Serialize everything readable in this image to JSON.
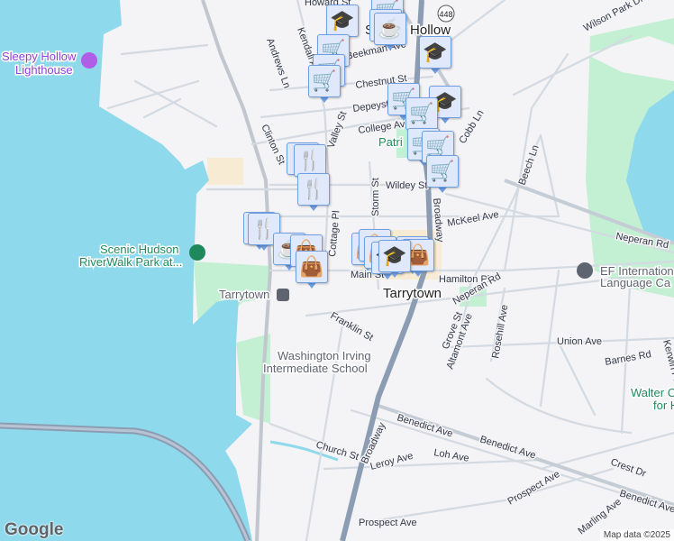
{
  "map": {
    "colors": {
      "water": "#8fd9ec",
      "land": "#f4f3f5",
      "park": "#c3efd2",
      "road": "#d3dae2",
      "highway": "#8c9db3",
      "marker_bg": "#dfe9fb",
      "marker_icon": "#0b4266"
    },
    "towns": {
      "sleepy_hollow": "Sleepy Hollow",
      "tarrytown": "Tarrytown"
    },
    "pois": {
      "lighthouse": [
        "Sleepy Hollow",
        "Lighthouse"
      ],
      "riverwalk": [
        "Scenic Hudson",
        "RiverWalk Park at..."
      ],
      "station": "Tarrytown",
      "school": [
        "Washington Irving",
        "Intermediate School"
      ],
      "ef": [
        "EF International",
        "Language Ca"
      ],
      "walter": [
        "Walter C",
        "for H"
      ],
      "patriot": "Patri"
    },
    "route_shield": "448",
    "streets": [
      "Howard St",
      "Andrews Ln",
      "Kendall Ave",
      "Beekman Ave",
      "Chestnut St",
      "Depeyster St",
      "College Ave",
      "Clinton St",
      "Valley St",
      "Wildey St",
      "Cobb Ln",
      "Beech Ln",
      "McKeel Ave",
      "Neperan Rd",
      "Wilson Park Dr",
      "Cottage Pl",
      "Storm St",
      "Broadway",
      "Main St",
      "Hamilton Pl",
      "Neperan Rd",
      "Franklin St",
      "Grove St",
      "Altamont Ave",
      "Rosehill Ave",
      "Union Ave",
      "Barnes Rd",
      "Kerwin Pl",
      "Benedict Ave",
      "Benedict Ave",
      "Benedict Ave",
      "Church St",
      "Broadway",
      "Leroy Ave",
      "Loh Ave",
      "Crest Dr",
      "Prospect Ave",
      "Prospect Ave",
      "Marling Ave"
    ],
    "markers": [
      "school",
      "shopping",
      "cafe",
      "cafe",
      "shopping",
      "shopping",
      "shopping",
      "school",
      "shopping",
      "school",
      "shopping",
      "shopping",
      "shopping",
      "shopping",
      "restaurant",
      "restaurant",
      "restaurant",
      "restaurant",
      "restaurant",
      "cafe",
      "shopping-bag",
      "shopping-bag",
      "shopping-bag",
      "shopping-bag",
      "shopping-bag",
      "shopping-bag",
      "shopping-bag",
      "school",
      "school"
    ],
    "logo": "Google",
    "attribution": "Map data ©2025"
  }
}
